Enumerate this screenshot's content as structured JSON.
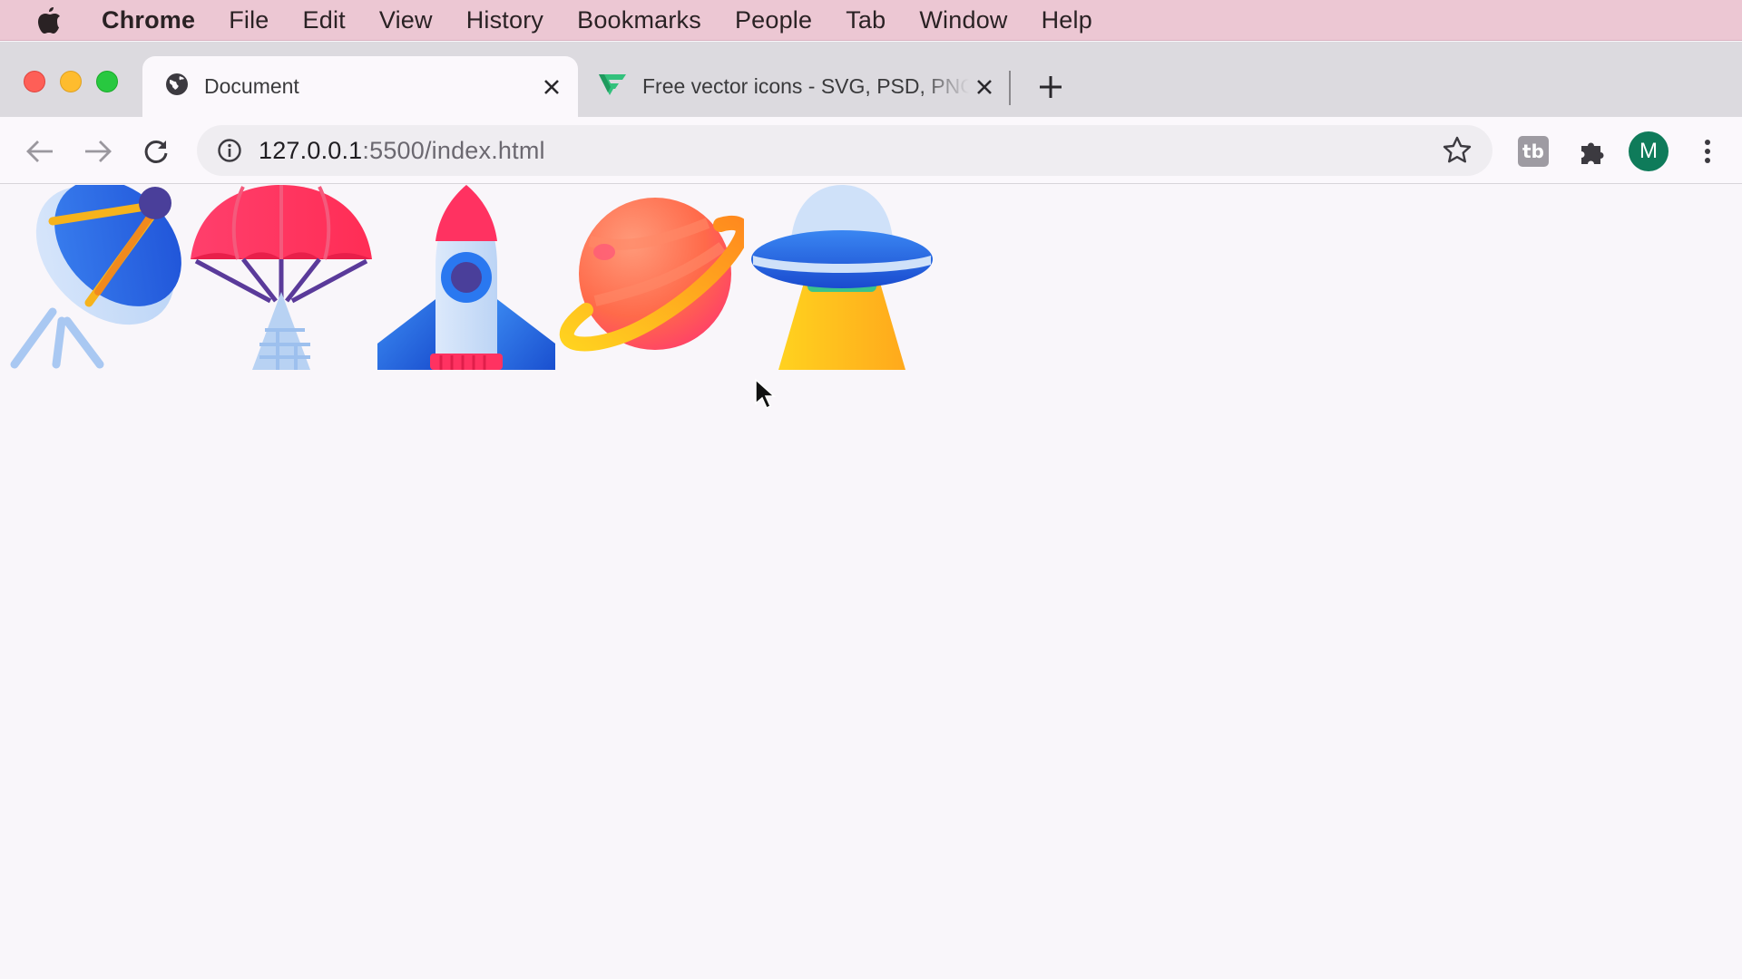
{
  "menubar": {
    "apple_icon": "apple-logo-icon",
    "items": [
      "Chrome",
      "File",
      "Edit",
      "View",
      "History",
      "Bookmarks",
      "People",
      "Tab",
      "Window",
      "Help"
    ]
  },
  "tabs": [
    {
      "title": "Document",
      "icon": "globe-icon",
      "active": true
    },
    {
      "title": "Free vector icons - SVG, PSD, PNG",
      "icon": "flaticon-logo-icon",
      "active": false
    }
  ],
  "toolbar": {
    "url_host": "127.0.0.1",
    "url_rest": ":5500/index.html",
    "extension_label": "tb",
    "avatar_letter": "M"
  },
  "page": {
    "icons": [
      "satellite-dish-icon",
      "parachute-icon",
      "rocket-icon",
      "planet-icon",
      "ufo-icon"
    ]
  },
  "colors": {
    "menubar_bg": "#ecc7d3",
    "tabstrip_bg": "#dcdadf",
    "page_bg": "#f9f6fa",
    "avatar_bg": "#0f7b5a"
  }
}
